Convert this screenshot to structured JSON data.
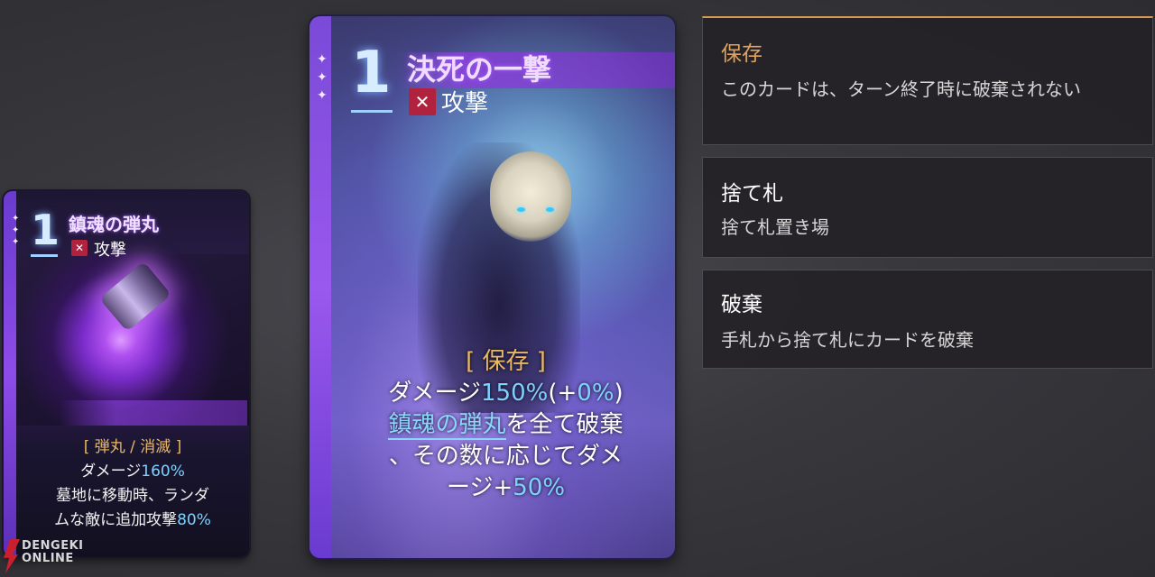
{
  "small_card": {
    "cost": "1",
    "title": "鎮魂の弾丸",
    "type": "攻撃",
    "keywords": "[ 弾丸 / 消滅 ]",
    "line1_prefix": "ダメージ",
    "line1_value": "160%",
    "line2": "墓地に移動時、ランダ",
    "line3_prefix": "ムな敵に追加攻撃",
    "line3_value": "80%"
  },
  "big_card": {
    "cost": "1",
    "title": "決死の一撃",
    "type": "攻撃",
    "keyword": "[ 保存 ]",
    "line1_prefix": "ダメージ",
    "line1_value": "150%",
    "line1_paren_open": "(+",
    "line1_bonus": "0%",
    "line1_paren_close": ")",
    "line2_link": "鎮魂の弾丸",
    "line2_rest": "を全て破棄",
    "line3": "、その数に応じてダメ",
    "line4_prefix": "ージ+",
    "line4_value": "50%"
  },
  "keywords_panel": [
    {
      "name": "保存",
      "desc": "このカードは、ターン終了時に破棄されない",
      "accent": "#e0a35f"
    },
    {
      "name": "捨て札",
      "desc": "捨て札置き場",
      "accent": "#ffffff"
    },
    {
      "name": "破棄",
      "desc": "手札から捨て札にカードを破棄",
      "accent": "#ffffff"
    }
  ],
  "watermark": {
    "line1": "DENGEKI",
    "line2": "ONLINE"
  },
  "colors": {
    "keyword": "#e9b866",
    "highlight": "#7fd0ff",
    "card_frame": "#8e4be8",
    "attack_icon": "#b0223d"
  },
  "icons": {
    "attack": "crossed-swords-icon",
    "sparkle": "sparkle-icon"
  }
}
